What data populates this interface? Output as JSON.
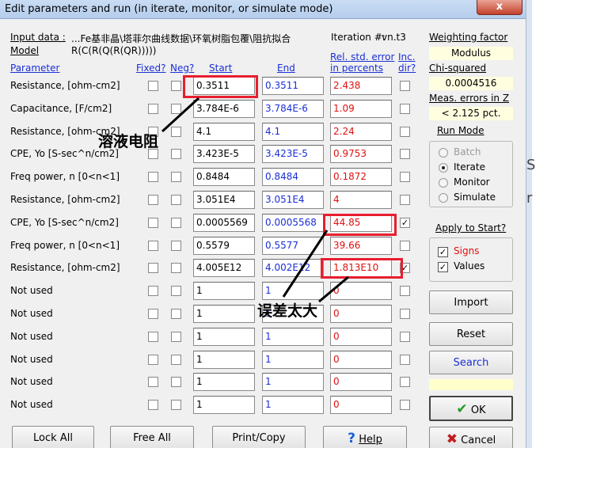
{
  "window": {
    "title": "Edit parameters and run (in iterate, monitor, or simulate mode)",
    "close_label": "x"
  },
  "header": {
    "input_data_label": "Input data :",
    "model_label": "Model",
    "input_data_value": "...Fe基非晶\\塔菲尔曲线数据\\环氧树脂包覆\\阻抗拟合",
    "model_value": "R(C(R(Q(R(QR)))))",
    "iteration_label": "Iteration #:",
    "iteration_value": "vn.t3"
  },
  "columns": {
    "parameter": "Parameter",
    "fixed": "Fixed?",
    "neg": "Neg?",
    "start": "Start",
    "end": "End",
    "rel_err_1": "Rel. std. error",
    "rel_err_2": "in percents",
    "inc_1": "Inc.",
    "inc_2": "dir?"
  },
  "rows": [
    {
      "name": "Resistance,   [ohm-cm2]",
      "start": "0.3511",
      "end": "0.3511",
      "err": "2.438",
      "inc": false
    },
    {
      "name": "Capacitance,    [F/cm2]",
      "start": "3.784E-6",
      "end": "3.784E-6",
      "err": "1.09",
      "inc": false
    },
    {
      "name": "Resistance,   [ohm-cm2]",
      "start": "4.1",
      "end": "4.1",
      "err": "2.24",
      "inc": false
    },
    {
      "name": "CPE, Yo  [S-sec^n/cm2]",
      "start": "3.423E-5",
      "end": "3.423E-5",
      "err": "0.9753",
      "inc": false
    },
    {
      "name": "Freq power, n    [0<n<1]",
      "start": "0.8484",
      "end": "0.8484",
      "err": "0.1872",
      "inc": false
    },
    {
      "name": "Resistance,   [ohm-cm2]",
      "start": "3.051E4",
      "end": "3.051E4",
      "err": "4",
      "inc": false
    },
    {
      "name": "CPE, Yo  [S-sec^n/cm2]",
      "start": "0.0005569",
      "end": "0.0005568",
      "err": "44.85",
      "inc": true
    },
    {
      "name": "Freq power, n    [0<n<1]",
      "start": "0.5579",
      "end": "0.5577",
      "err": "39.66",
      "inc": false
    },
    {
      "name": "Resistance,   [ohm-cm2]",
      "start": "4.005E12",
      "end": "4.002E12",
      "err": "1.813E10",
      "inc": true
    },
    {
      "name": "Not used",
      "start": "1",
      "end": "1",
      "err": "0",
      "inc": false
    },
    {
      "name": "Not used",
      "start": "1",
      "end": "1",
      "err": "0",
      "inc": false
    },
    {
      "name": "Not used",
      "start": "1",
      "end": "1",
      "err": "0",
      "inc": false
    },
    {
      "name": "Not used",
      "start": "1",
      "end": "1",
      "err": "0",
      "inc": false
    },
    {
      "name": "Not used",
      "start": "1",
      "end": "1",
      "err": "0",
      "inc": false
    },
    {
      "name": "Not used",
      "start": "1",
      "end": "1",
      "err": "0",
      "inc": false
    }
  ],
  "side": {
    "weighting_label": "Weighting factor",
    "weighting_value": "Modulus",
    "chi_label": "Chi-squared",
    "chi_value": "0.0004516",
    "meas_label": "Meas. errors in Z",
    "meas_value": "< 2.125 pct.",
    "run_mode_label": "Run Mode",
    "modes": [
      "Batch",
      "Iterate",
      "Monitor",
      "Simulate"
    ],
    "selected_mode": "Iterate",
    "apply_label": "Apply to Start?",
    "signs_label": "Signs",
    "values_label": "Values",
    "import_label": "Import",
    "reset_label": "Reset",
    "search_label": "Search",
    "ok_label": "OK",
    "cancel_label": "Cancel"
  },
  "bottom": {
    "lock_all": "Lock All",
    "free_all": "Free All",
    "print_copy": "Print/Copy",
    "help": "Help"
  },
  "annotations": {
    "solution_resistance": "溶液电阻",
    "error_too_large": "误差太大"
  },
  "colors": {
    "highlight": "#e81e2e",
    "end_text": "#1a2fd6",
    "error_text": "#e01010"
  }
}
